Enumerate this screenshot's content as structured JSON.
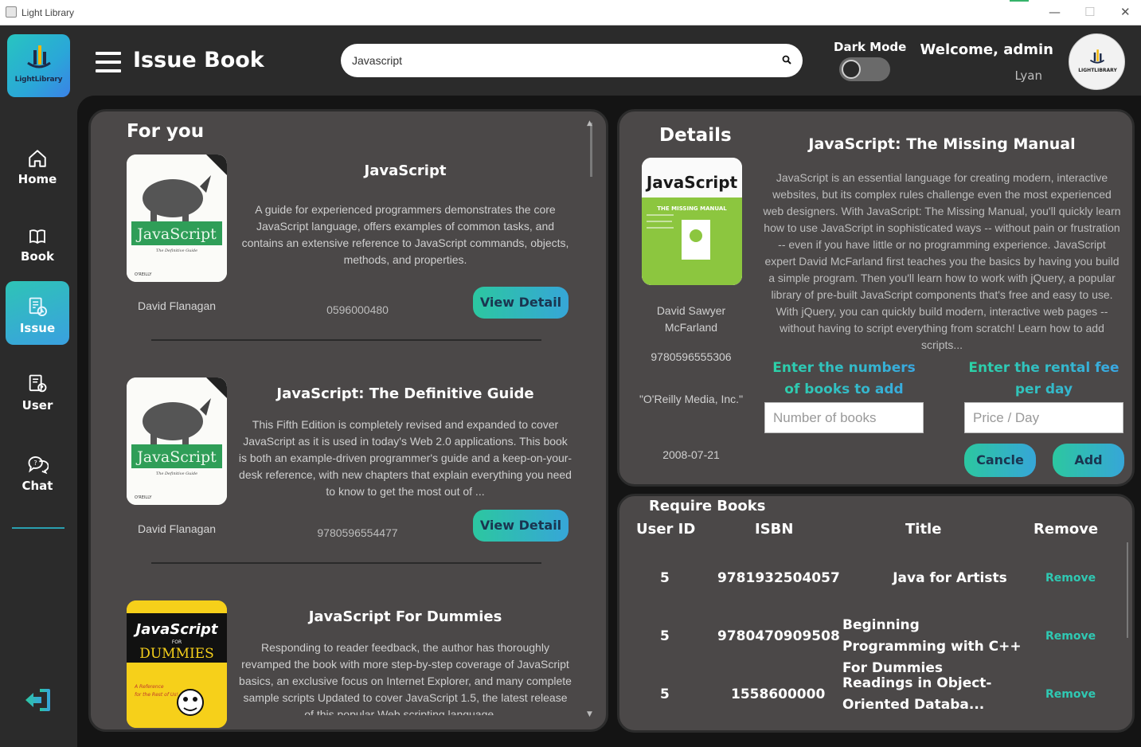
{
  "window": {
    "title": "Light Library",
    "minimize": "—",
    "maximize": "☐",
    "close": "✕"
  },
  "sidebar": {
    "logo_text": "LightLibrary",
    "items": [
      {
        "label": "Home",
        "icon": "home-icon"
      },
      {
        "label": "Book",
        "icon": "book-icon"
      },
      {
        "label": "Issue",
        "icon": "issue-icon",
        "active": true
      },
      {
        "label": "User",
        "icon": "user-icon"
      },
      {
        "label": "Chat",
        "icon": "chat-icon"
      }
    ],
    "logout_icon": "logout-icon"
  },
  "header": {
    "title": "Issue Book",
    "search_value": "Javascript",
    "dark_mode_label": "Dark Mode",
    "dark_mode_on": false,
    "welcome": "Welcome, admin",
    "username": "Lyan",
    "avatar_text": "LIGHTLIBRARY"
  },
  "for_you": {
    "heading": "For you",
    "books": [
      {
        "title": "JavaScript",
        "description": "A guide for experienced programmers demonstrates the core JavaScript language, offers examples of common tasks, and contains an extensive reference to JavaScript commands, objects, methods, and properties.",
        "author": "David Flanagan",
        "isbn": "0596000480",
        "button": "View Detail",
        "cover_text": "JavaScript",
        "cover_subtext": "The Definitive Guide"
      },
      {
        "title": "JavaScript: The Definitive Guide",
        "description": "This Fifth Edition is completely revised and expanded to cover JavaScript as it is used in today's Web 2.0 applications. This book is both an example-driven programmer's guide and a keep-on-your-desk reference, with new chapters that explain everything you need to know to get the most out of ...",
        "author": "David Flanagan",
        "isbn": "9780596554477",
        "button": "View Detail",
        "cover_text": "JavaScript",
        "cover_subtext": "The Definitive Guide"
      },
      {
        "title": "JavaScript For Dummies",
        "description": "Responding to reader feedback, the author has thoroughly revamped the book with more step-by-step coverage of JavaScript basics, an exclusive focus on Internet Explorer, and many complete sample scripts Updated to cover JavaScript 1.5, the latest release of this popular Web scripting language ...",
        "cover_text": "JavaScript",
        "cover_for": "FOR",
        "cover_subtext": "DUMMIES"
      }
    ]
  },
  "details": {
    "heading": "Details",
    "title": "JavaScript: The Missing Manual",
    "description": "JavaScript is an essential language for creating modern, interactive websites, but its complex rules challenge even the most experienced web designers. With JavaScript: The Missing Manual, you'll quickly learn how to use JavaScript in sophisticated ways -- without pain or frustration -- even if you have little or no programming experience. JavaScript expert David McFarland first teaches you the basics by having you build a simple program. Then you'll learn how to work with jQuery, a popular library of pre-built JavaScript components that's free and easy to use. With jQuery, you can quickly build modern, interactive web pages -- without having to script everything from scratch! Learn how to add scripts...",
    "author": "David Sawyer McFarland",
    "isbn": "9780596555306",
    "publisher": "\"O'Reilly Media, Inc.\"",
    "date": "2008-07-21",
    "cover_text": "JavaScript",
    "cover_sub": "THE MISSING MANUAL",
    "numbers_label": "Enter the numbers of books to add",
    "numbers_placeholder": "Number of books",
    "fee_label": "Enter the rental fee per day",
    "fee_placeholder": "Price / Day",
    "cancel_button": "Cancle",
    "add_button": "Add"
  },
  "require_books": {
    "heading": "Require Books",
    "columns": [
      "User ID",
      "ISBN",
      "Title",
      "Remove"
    ],
    "rows": [
      {
        "user_id": "5",
        "isbn": "9781932504057",
        "title": "Java for Artists",
        "remove": "Remove"
      },
      {
        "user_id": "5",
        "isbn": "9780470909508",
        "title": "Beginning Programming with C++ For Dummies",
        "remove": "Remove"
      },
      {
        "user_id": "5",
        "isbn": "1558600000",
        "title": "Readings in Object-Oriented Databa...",
        "remove": "Remove"
      }
    ]
  },
  "colors": {
    "accent_start": "#2cc7a0",
    "accent_end": "#36a6d8",
    "panel_bg": "#4b4848",
    "app_bg": "#2b2b2b"
  }
}
